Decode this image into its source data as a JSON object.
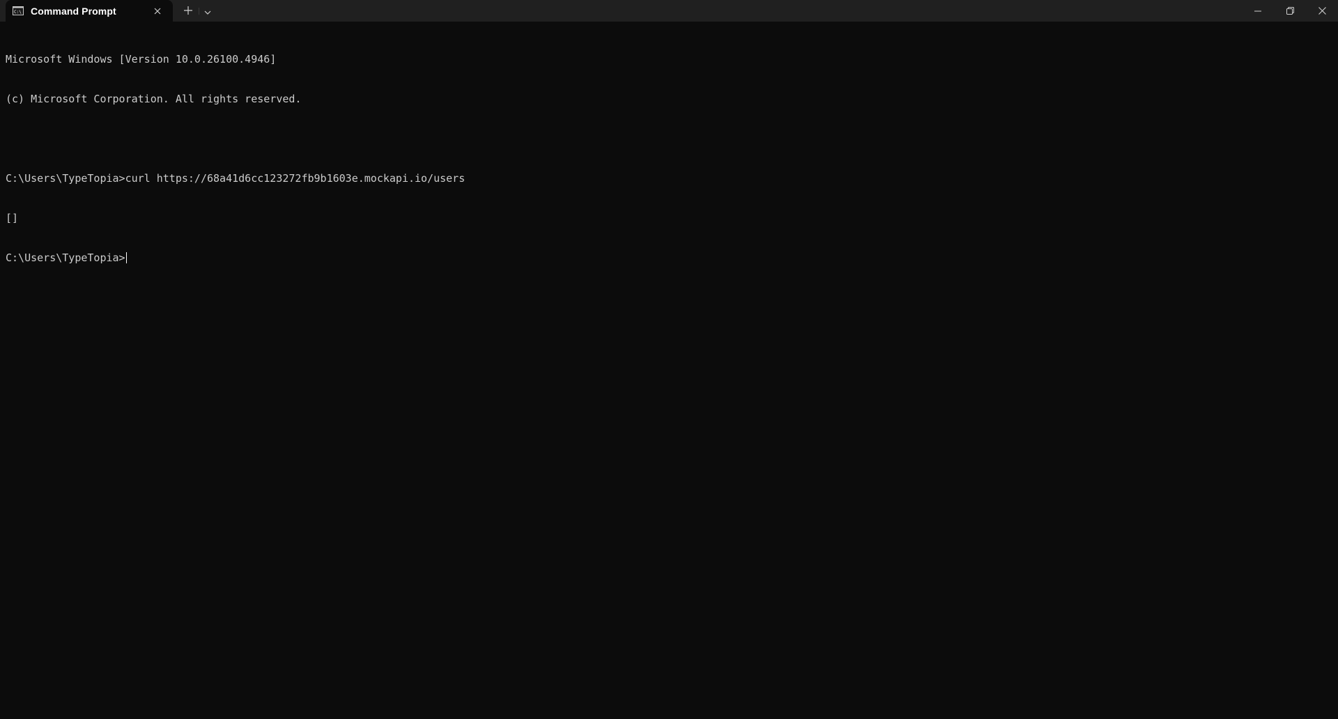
{
  "tab": {
    "title": "Command Prompt",
    "icon": "cmd-icon"
  },
  "window_controls": {
    "minimize": "minimize-icon",
    "restore": "restore-icon",
    "close": "close-icon"
  },
  "terminal": {
    "lines": [
      "Microsoft Windows [Version 10.0.26100.4946]",
      "(c) Microsoft Corporation. All rights reserved.",
      "",
      "C:\\Users\\TypeTopia>curl https://68a41d6cc123272fb9b1603e.mockapi.io/users",
      "[]"
    ],
    "prompt": "C:\\Users\\TypeTopia>"
  },
  "colors": {
    "background": "#0c0c0c",
    "titlebar": "#202020",
    "text": "#cccccc"
  }
}
